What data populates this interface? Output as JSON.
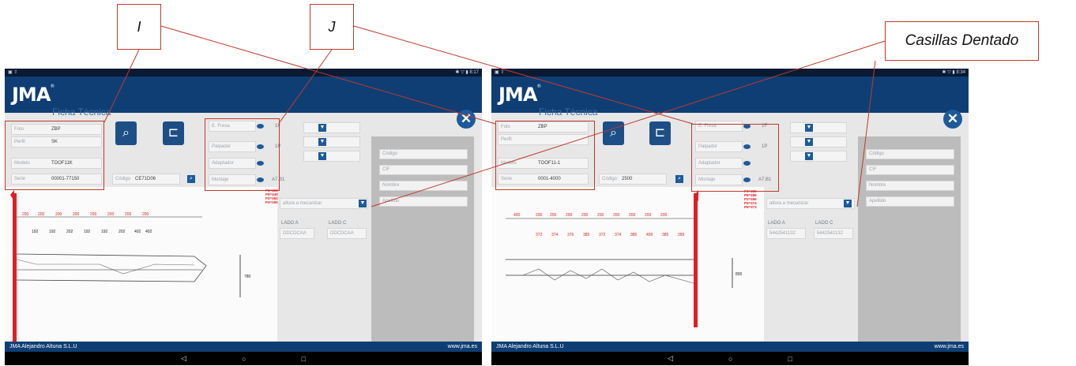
{
  "callouts": {
    "i_label": "I",
    "j_label": "J",
    "dentado_label": "Casillas Dentado"
  },
  "left": {
    "status": {
      "left": "▣ ⇪",
      "right": "✱ ▽ ▮ 8:17"
    },
    "brand": "JMA",
    "title": "Ficha Técnica",
    "close": "✕",
    "fields": {
      "foto_label": "Foto",
      "foto_value": "ZBP",
      "perfil_label": "Perfil",
      "perfil_value": "SK",
      "modelo_label": "Modelo",
      "modelo_value": "TOOF11K",
      "serie_label": "Serie",
      "serie_value": "00001-77150",
      "codigo_label": "Código",
      "codigo_value": "CE71D06"
    },
    "options": {
      "fresa": "E. Fresa",
      "palpador": "Palpador",
      "adaptador": "Adaptador",
      "montaje": "Montaje",
      "fresa_code": "1F",
      "palpador_code": "1P",
      "montaje_code": "A7.B1"
    },
    "dropdown": "altura a mecanizar",
    "lado_a_label": "LADO A",
    "lado_a_value": "DDCDCAA",
    "lado_b_label": "LADO C",
    "lado_b_value": "DDCDCAA",
    "side": {
      "codigo": "Código",
      "cif": "CIF",
      "nombre": "Nombre",
      "apellido": "Apellido"
    },
    "red_lines": [
      "P1=460",
      "P8=440",
      "P2=362",
      "P4=190"
    ],
    "scale_label": "780",
    "footer_left": "JMA Alejandro Altuna S.L.U",
    "footer_right": "www.jma.es"
  },
  "right": {
    "status": {
      "left": "▣ ⇪",
      "right": "✱ ▽ ▮ 8:34"
    },
    "brand": "JMA",
    "title": "Ficha Técnica",
    "close": "✕",
    "fields": {
      "foto_label": "Foto",
      "foto_value": "ZBP",
      "perfil_label": "Perfil",
      "perfil_value": "",
      "modelo_label": "Modelo",
      "modelo_value": "TOOF11-1",
      "serie_label": "Serie",
      "serie_value": "0001-4000",
      "codigo_label": "Código",
      "codigo_value": "2500"
    },
    "options": {
      "fresa": "E. Fresa",
      "palpador": "Palpador",
      "adaptador": "Adaptador",
      "montaje": "Montaje",
      "fresa_code": "1F",
      "palpador_code": "1P",
      "montaje_code": "A7.B1"
    },
    "dropdown": "altura a mecanizar",
    "lado_a_label": "LADO A",
    "lado_a_value": "5442541132",
    "lado_b_label": "LADO C",
    "lado_b_value": "5442541132",
    "side": {
      "codigo": "Código",
      "cif": "CIF",
      "nombre": "Nombre",
      "apellido": "Apellido"
    },
    "red_lines": [
      "P1=460",
      "P8=499",
      "P2=456",
      "P4=374",
      "P6=373"
    ],
    "scale_label": "800",
    "footer_left": "JMA Alejandro Altuna S.L.U",
    "footer_right": "www.jma.es"
  },
  "nav": {
    "back": "◁",
    "home": "○",
    "recent": "□"
  },
  "colors": {
    "header": "#0f3e74",
    "accent": "#1d5a99",
    "callout_border": "#c0392b",
    "key_red": "#e02020"
  }
}
